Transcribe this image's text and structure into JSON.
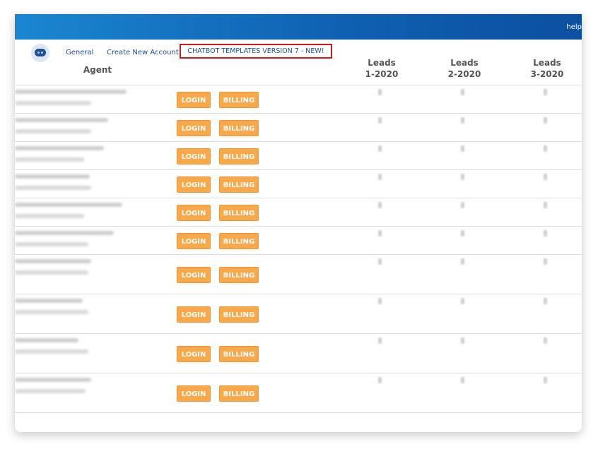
{
  "topbar": {
    "help_label": "help"
  },
  "nav": {
    "general": "General",
    "create_account": "Create New Account",
    "chatbot_templates": "CHATBOT TEMPLATES VERSION 7 - NEW!"
  },
  "table": {
    "headers": {
      "agent": "Agent",
      "leads": [
        {
          "line1": "Leads",
          "line2": "1-2020"
        },
        {
          "line1": "Leads",
          "line2": "2-2020"
        },
        {
          "line1": "Leads",
          "line2": "3-2020"
        }
      ]
    },
    "login_label": "LOGIN",
    "billing_label": "BILLING",
    "row_count": 10
  },
  "colors": {
    "topbar": "#0f5fb0",
    "button": "#f9a84a",
    "highlight_border": "#d01a1a",
    "nav_text": "#1a4f8c"
  }
}
